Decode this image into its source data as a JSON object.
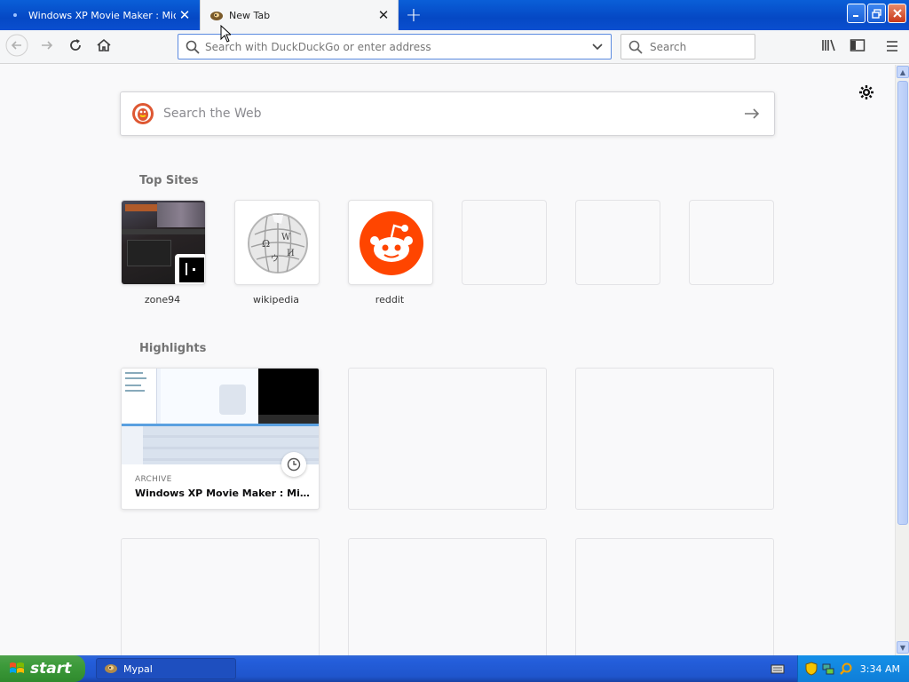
{
  "tabs": [
    {
      "title": "Windows XP Movie Maker : Microsoft",
      "active": false
    },
    {
      "title": "New Tab",
      "active": true
    }
  ],
  "navbar": {
    "url_placeholder": "Search with DuckDuckGo or enter address",
    "search_placeholder": "Search"
  },
  "newtab": {
    "web_search_placeholder": "Search the Web",
    "top_sites_title": "Top Sites",
    "top_sites": [
      {
        "label": "zone94",
        "icon": "zone94-thumbnail"
      },
      {
        "label": "wikipedia",
        "icon": "wikipedia-globe-icon"
      },
      {
        "label": "reddit",
        "icon": "reddit-icon"
      },
      {
        "label": "",
        "icon": "empty"
      },
      {
        "label": "",
        "icon": "empty"
      },
      {
        "label": "",
        "icon": "empty"
      }
    ],
    "highlights_title": "Highlights",
    "highlights": [
      {
        "source": "ARCHIVE",
        "title": "Windows XP Movie Maker : Micr...",
        "icon": "clock-icon"
      }
    ]
  },
  "taskbar": {
    "start_label": "start",
    "items": [
      {
        "label": "Mypal"
      }
    ],
    "clock": "3:34 AM"
  },
  "colors": {
    "accent": "#0a5fd8",
    "reddit": "#ff4500",
    "taskbar": "#245edb",
    "start": "#3c9a3a"
  }
}
